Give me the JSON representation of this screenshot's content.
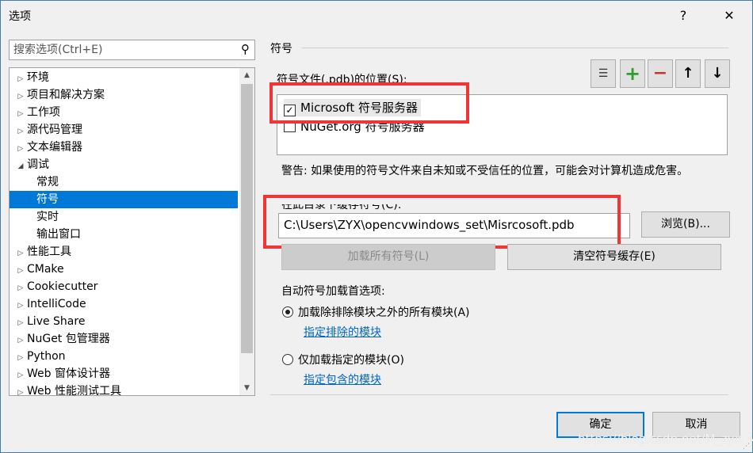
{
  "window": {
    "title": "选项",
    "help": "?",
    "close": "✕"
  },
  "search": {
    "placeholder": "搜索选项(Ctrl+E)"
  },
  "tree": [
    {
      "label": "环境",
      "arrow": "▷",
      "level": 0
    },
    {
      "label": "项目和解决方案",
      "arrow": "▷",
      "level": 0
    },
    {
      "label": "工作项",
      "arrow": "▷",
      "level": 0
    },
    {
      "label": "源代码管理",
      "arrow": "▷",
      "level": 0
    },
    {
      "label": "文本编辑器",
      "arrow": "▷",
      "level": 0
    },
    {
      "label": "调试",
      "arrow": "◢",
      "level": 0
    },
    {
      "label": "常规",
      "arrow": "",
      "level": 1
    },
    {
      "label": "符号",
      "arrow": "",
      "level": 1,
      "selected": true
    },
    {
      "label": "实时",
      "arrow": "",
      "level": 1
    },
    {
      "label": "输出窗口",
      "arrow": "",
      "level": 1
    },
    {
      "label": "性能工具",
      "arrow": "▷",
      "level": 0
    },
    {
      "label": "CMake",
      "arrow": "▷",
      "level": 0
    },
    {
      "label": "Cookiecutter",
      "arrow": "▷",
      "level": 0
    },
    {
      "label": "IntelliCode",
      "arrow": "▷",
      "level": 0
    },
    {
      "label": "Live Share",
      "arrow": "▷",
      "level": 0
    },
    {
      "label": "NuGet 包管理器",
      "arrow": "▷",
      "level": 0
    },
    {
      "label": "Python",
      "arrow": "▷",
      "level": 0
    },
    {
      "label": "Web 窗体设计器",
      "arrow": "▷",
      "level": 0
    },
    {
      "label": "Web 性能测试工具",
      "arrow": "▷",
      "level": 0
    }
  ],
  "panel": {
    "section": "符号",
    "locations_label": "符号文件(.pdb)的位置(S):",
    "servers": [
      {
        "label": "Microsoft 符号服务器",
        "checked": true
      },
      {
        "label": "NuGet.org 符号服务器",
        "checked": false
      }
    ],
    "warning": "警告: 如果使用的符号文件来自未知或不受信任的位置，可能会对计算机造成危害。",
    "cache_label": "在此目录下缓存符号(C):",
    "cache_path": "C:\\Users\\ZYX\\opencvwindows_set\\Misrcosoft.pdb",
    "browse": "浏览(B)...",
    "load_all": "加载所有符号(L)",
    "clear_cache": "清空符号缓存(E)",
    "auto_label": "自动符号加载首选项:",
    "opt1": "加载除排除模块之外的所有模块(A)",
    "link1": "指定排除的模块",
    "opt2": "仅加载指定的模块(O)",
    "link2": "指定包含的模块"
  },
  "footer": {
    "ok": "确定",
    "cancel": "取消"
  },
  "watermark": "https://blog.csdn.net/M_zyx_M",
  "colors": {
    "accent": "#0078d7",
    "highlight": "#f03535",
    "add": "#2e9e2e",
    "remove": "#c0392b"
  }
}
